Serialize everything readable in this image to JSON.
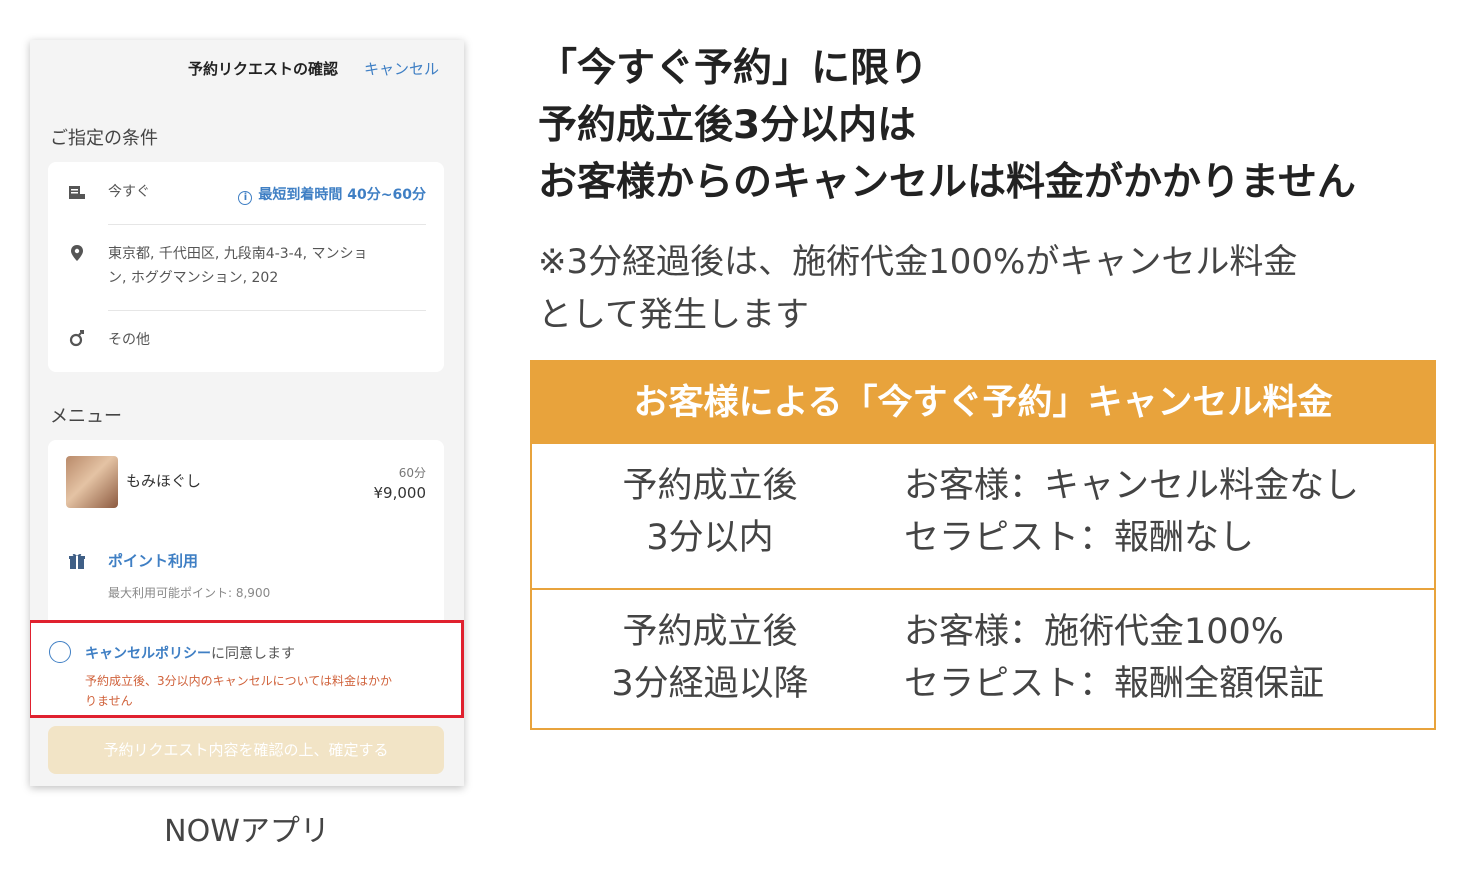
{
  "phone": {
    "header": {
      "title": "予約リクエストの確認",
      "cancel_label": "キャンセル"
    },
    "conditions": {
      "section_label": "ご指定の条件",
      "timing": "今すぐ",
      "eta": "最短到着時間 40分~60分",
      "address_line1": "東京都, 千代田区, 九段南4-3-4, マンショ",
      "address_line2": "ン, ホググマンション, 202",
      "gender": "その他"
    },
    "menu": {
      "section_label": "メニュー",
      "item_name": "もみほぐし",
      "duration": "60分",
      "price": "¥9,000",
      "points_label": "ポイント利用",
      "points_max": "最大利用可能ポイント: 8,900"
    },
    "policy": {
      "link_text": "キャンセルポリシー",
      "suffix": "に同意します",
      "warning_line1": "予約成立後、3分以内のキャンセルについては料金はかか",
      "warning_line2": "りません"
    },
    "confirm_button": "予約リクエスト内容を確認の上、確定する"
  },
  "caption": "NOWアプリ",
  "headline": {
    "line1": "「今すぐ予約」に限り",
    "line2": "予約成立後3分以内は",
    "line3": "お客様からのキャンセルは料金がかかりません"
  },
  "note": {
    "line1": "※3分経過後は、施術代金100%がキャンセル料金",
    "line2": "として発生します"
  },
  "table": {
    "title": "お客様による「今すぐ予約」キャンセル料金",
    "rows": [
      {
        "period_line1": "予約成立後",
        "period_line2": "3分以内",
        "customer": "お客様：キャンセル料金なし",
        "therapist": "セラピスト：報酬なし"
      },
      {
        "period_line1": "予約成立後",
        "period_line2": "3分経過以降",
        "customer": "お客様：施術代金100%",
        "therapist": "セラピスト：報酬全額保証"
      }
    ]
  },
  "colors": {
    "accent_orange": "#e8a33c",
    "link_blue": "#3f7fc4",
    "highlight_red": "#e0212f",
    "warning_text": "#d0623b"
  }
}
